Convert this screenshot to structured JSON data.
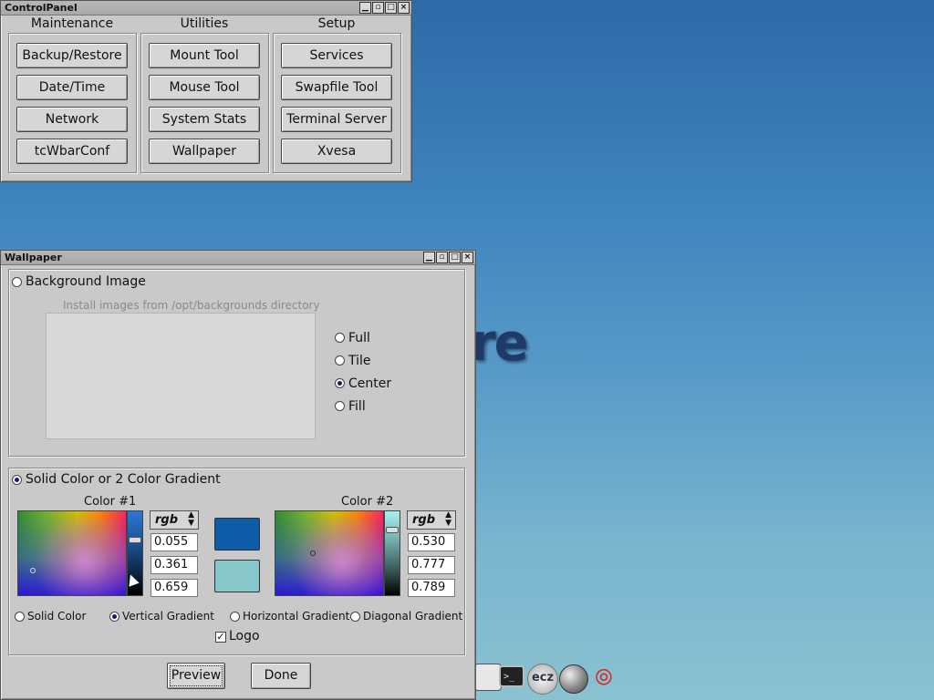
{
  "control_panel": {
    "title": "ControlPanel",
    "columns": [
      {
        "heading": "Maintenance",
        "buttons": [
          "Backup/Restore",
          "Date/Time",
          "Network",
          "tcWbarConf"
        ]
      },
      {
        "heading": "Utilities",
        "buttons": [
          "Mount Tool",
          "Mouse Tool",
          "System Stats",
          "Wallpaper"
        ]
      },
      {
        "heading": "Setup",
        "buttons": [
          "Services",
          "Swapfile Tool",
          "Terminal Server",
          "Xvesa"
        ]
      }
    ]
  },
  "wallpaper": {
    "title": "Wallpaper",
    "bg_image_label": "Background Image",
    "bg_image_hint": "Install images from /opt/backgrounds directory",
    "placement_options": [
      {
        "label": "Full",
        "selected": false
      },
      {
        "label": "Tile",
        "selected": false
      },
      {
        "label": "Center",
        "selected": true
      },
      {
        "label": "Fill",
        "selected": false
      }
    ],
    "solid_label": "Solid Color or 2 Color Gradient",
    "color1": {
      "label": "Color #1",
      "mode": "rgb",
      "values": [
        "0.055",
        "0.361",
        "0.659"
      ],
      "hex": "#0e5ca8"
    },
    "color2": {
      "label": "Color #2",
      "mode": "rgb",
      "values": [
        "0.530",
        "0.777",
        "0.789"
      ],
      "hex": "#87c6c9"
    },
    "gradient_options": [
      {
        "label": "Solid Color",
        "selected": false
      },
      {
        "label": "Vertical Gradient",
        "selected": true
      },
      {
        "label": "Horizontal Gradient",
        "selected": false
      },
      {
        "label": "Diagonal Gradient",
        "selected": false
      }
    ],
    "logo_label": "Logo",
    "logo_checked": true,
    "preview_label": "Preview",
    "done_label": "Done"
  },
  "desktop": {
    "logo_fragment": "re"
  },
  "window_buttons": [
    "_",
    "▢",
    "▢",
    "×"
  ]
}
